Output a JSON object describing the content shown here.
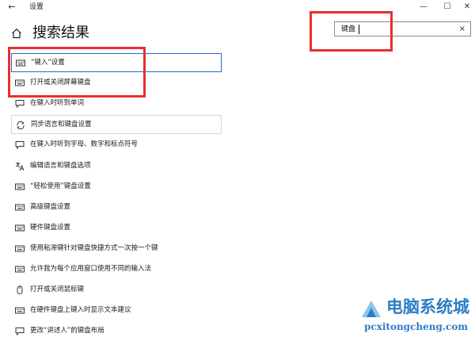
{
  "window": {
    "title": "设置",
    "back_glyph": "←",
    "min_glyph": "—",
    "max_glyph": "☐",
    "close_glyph": "✕"
  },
  "header": {
    "title": "搜索结果"
  },
  "search": {
    "value": "键盘",
    "clear_glyph": "×"
  },
  "results": [
    {
      "label": "“键入”设置",
      "icon": "keyboard-icon",
      "state": "selected"
    },
    {
      "label": "打开或关闭屏幕键盘",
      "icon": "keyboard-icon",
      "state": "normal"
    },
    {
      "label": "在键入时听到单词",
      "icon": "speech-icon",
      "state": "normal"
    },
    {
      "label": "同步语言和键盘设置",
      "icon": "sync-icon",
      "state": "hovered"
    },
    {
      "label": "在键入时听到字母、数字和标点符号",
      "icon": "speech-icon",
      "state": "normal"
    },
    {
      "label": "编辑语言和键盘选项",
      "icon": "language-icon",
      "state": "normal"
    },
    {
      "label": "“轻松使用”键盘设置",
      "icon": "keyboard-icon",
      "state": "normal"
    },
    {
      "label": "高级键盘设置",
      "icon": "keyboard-icon",
      "state": "normal"
    },
    {
      "label": "硬件键盘设置",
      "icon": "keyboard-icon",
      "state": "normal"
    },
    {
      "label": "使用粘滞键针对键盘快捷方式一次按一个键",
      "icon": "keyboard-icon",
      "state": "normal"
    },
    {
      "label": "允许我为每个应用窗口使用不同的输入法",
      "icon": "keyboard-icon",
      "state": "normal"
    },
    {
      "label": "打开或关闭鼠标键",
      "icon": "mouse-icon",
      "state": "normal"
    },
    {
      "label": "在硬件键盘上键入时显示文本建议",
      "icon": "keyboard-icon",
      "state": "normal"
    },
    {
      "label": "更改“讲述人”的键盘布局",
      "icon": "speech-icon",
      "state": "normal"
    }
  ],
  "watermark": {
    "text": "电脑系统城",
    "url": "pcxitongcheng.com"
  },
  "colors": {
    "accent": "#1e6bd6",
    "highlight": "#e8302f",
    "watermark": "#2c7ec5"
  }
}
